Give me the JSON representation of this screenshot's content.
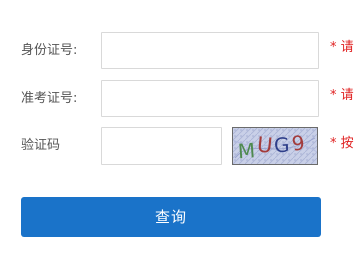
{
  "form": {
    "id_card": {
      "label": "身份证号:",
      "value": "",
      "hint": "* 请"
    },
    "exam_number": {
      "label": "准考证号:",
      "value": "",
      "hint": "* 请"
    },
    "captcha": {
      "label": "验证码",
      "value": "",
      "hint": "* 按",
      "image_text": "MUG9"
    },
    "submit_label": "查询"
  },
  "colors": {
    "hint": "#e02020",
    "button": "#1a73c9",
    "border": "#d9d9d9"
  }
}
